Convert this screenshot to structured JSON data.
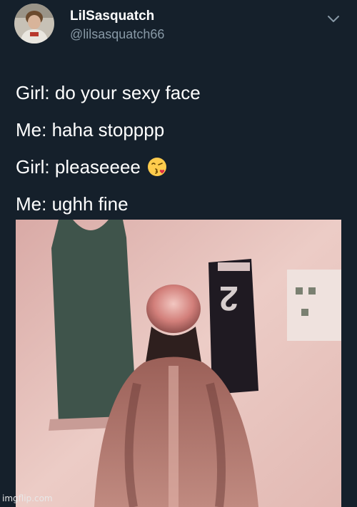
{
  "tweet": {
    "display_name": "LilSasquatch",
    "handle": "@lilsasquatch66",
    "lines": [
      "Girl: do your sexy face",
      "Me: haha stopppp",
      "Girl: pleaseeee",
      "Me: ughh fine"
    ],
    "emoji": "face-blowing-a-kiss",
    "menu_icon": "chevron-down-icon"
  },
  "media": {
    "jersey_number": "2"
  },
  "watermark": "imgflip.com",
  "colors": {
    "background": "#15202b",
    "secondary_text": "#8899a6",
    "primary_text": "#ffffff"
  }
}
